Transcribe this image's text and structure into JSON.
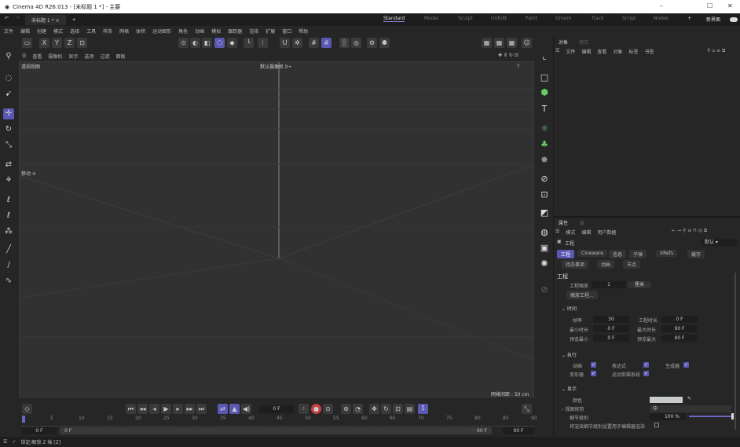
{
  "window": {
    "title": "Cinema 4D R26.013 - [未标题 1 *] - 主要",
    "minimize": "–",
    "maximize": "☐",
    "close": "✕"
  },
  "tabs": {
    "document": "未标题 1 *",
    "close": "×",
    "add": "+",
    "layouts": [
      "Standard",
      "Model",
      "Sculpt",
      "UVEdit",
      "Paint",
      "Groom",
      "Track",
      "Script",
      "Nodes"
    ],
    "add_layout": "+",
    "new_ui": "新界面"
  },
  "menu": [
    "文件",
    "编辑",
    "创建",
    "模式",
    "选择",
    "工具",
    "样条",
    "网格",
    "体积",
    "运动图形",
    "角色",
    "动画",
    "模拟",
    "跟踪器",
    "渲染",
    "扩展",
    "窗口",
    "帮助"
  ],
  "toolbar": {
    "axes": [
      "X",
      "Y",
      "Z"
    ]
  },
  "viewport": {
    "menu": [
      "查看",
      "摄像机",
      "显示",
      "选项",
      "过滤",
      "面板"
    ],
    "name": "透视视图",
    "camera": "默认摄像机 ᐅ•",
    "tool_label": "移动 ✛",
    "grid_spacing": "网格间距 : 50 cm",
    "axis_y": "Y"
  },
  "object_panel": {
    "tabs": [
      "对象",
      "场次"
    ],
    "menu": [
      "文件",
      "编辑",
      "查看",
      "对象",
      "标签",
      "书签"
    ]
  },
  "attr_panel": {
    "tabs": [
      "属性",
      "层"
    ],
    "menu": [
      "模式",
      "编辑",
      "用户数据"
    ],
    "object": "工程",
    "preset": "默认",
    "subtabs": [
      "工程",
      "Cineware",
      "信息",
      "子弹",
      "XRefs",
      "缓存",
      "待办事项",
      "动画",
      "节点"
    ],
    "section": "工程",
    "scale_label": "工程缩放",
    "scale_value": "1",
    "scale_unit": "厘米",
    "scale_button": "缩放工程...",
    "time": {
      "title": "时间",
      "fps_label": "帧率",
      "fps": "30",
      "duration_label": "工程时长",
      "duration": "0 F",
      "min_label": "最小时长",
      "min": "0 F",
      "max_label": "最大时长",
      "max": "90 F",
      "pmin_label": "预览最小",
      "pmin": "0 F",
      "pmax_label": "预览最大",
      "pmax": "90 F"
    },
    "exec": {
      "title": "执行",
      "items": [
        {
          "label": "动画",
          "checked": true
        },
        {
          "label": "表达式",
          "checked": true
        },
        {
          "label": "生成器",
          "checked": true
        },
        {
          "label": "变形器",
          "checked": true
        },
        {
          "label": "运动剪辑系统",
          "checked": true
        }
      ]
    },
    "display": {
      "title": "显示",
      "color_label": "颜色",
      "color": "#c8cccc",
      "clip_label": "视图修剪",
      "clip": "中",
      "lod_label": "细节级别",
      "lod": "100 %",
      "lod_fraction": 1.0,
      "render_lod_label": "将渲染细节级别设置用于编辑器渲染",
      "render_lod": false
    }
  },
  "timeline": {
    "current": "0 F",
    "ticks": [
      "0",
      "5",
      "10",
      "15",
      "20",
      "25",
      "30",
      "35",
      "40",
      "45",
      "50",
      "55",
      "60",
      "65",
      "70",
      "75",
      "80",
      "85",
      "90"
    ],
    "start": "0 F",
    "range_start": "0 F",
    "range_end": "90 F",
    "end": "90 F"
  },
  "status": {
    "text": "锁定/解锁 Z 轴 [Z]"
  },
  "colors": {
    "accent": "#5b58b4",
    "record": "#c84040"
  }
}
